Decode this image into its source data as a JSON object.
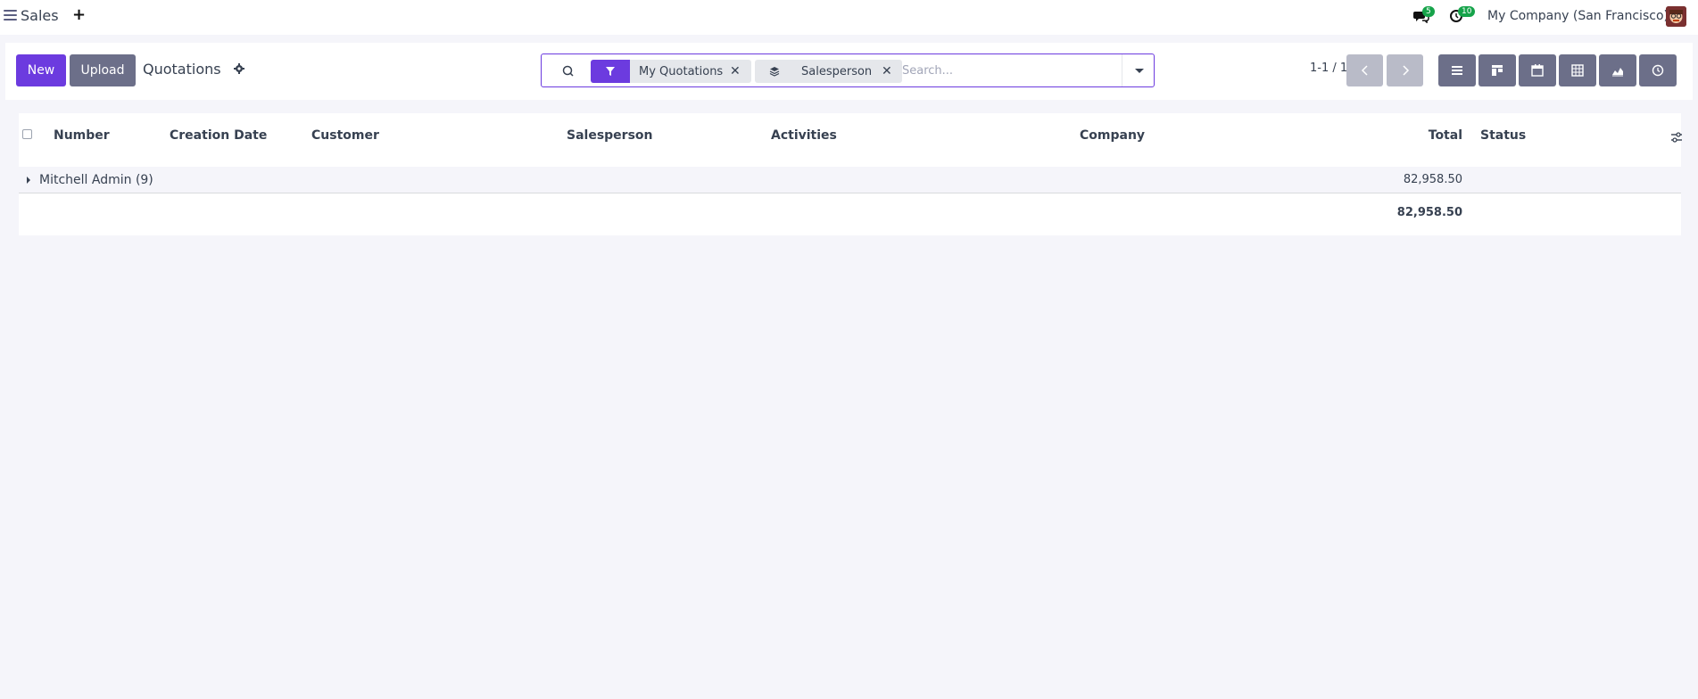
{
  "navbar": {
    "app_name": "Sales",
    "plus_icon": "plus-icon",
    "messages_badge": "5",
    "activities_badge": "10",
    "company": "My Company (San Francisco)"
  },
  "control_panel": {
    "new_label": "New",
    "upload_label": "Upload",
    "title": "Quotations",
    "search": {
      "facets": [
        {
          "icon": "filter-icon",
          "label": "My Quotations"
        },
        {
          "icon": "layers-icon",
          "label": "Salesperson"
        }
      ],
      "placeholder": "Search..."
    },
    "pager": "1-1 / 1",
    "views": [
      "list-view",
      "kanban-view",
      "calendar-view",
      "pivot-view",
      "graph-view",
      "activity-view"
    ]
  },
  "table": {
    "columns": [
      "Number",
      "Creation Date",
      "Customer",
      "Salesperson",
      "Activities",
      "Company",
      "Total",
      "Status"
    ],
    "groups": [
      {
        "label": "Mitchell Admin (9)",
        "total": "82,958.50"
      }
    ],
    "grand_total": "82,958.50"
  },
  "colors": {
    "primary": "#6c3bdf",
    "secondary": "#6c6f89",
    "badge": "#16a34a",
    "background": "#f5f5fa"
  }
}
